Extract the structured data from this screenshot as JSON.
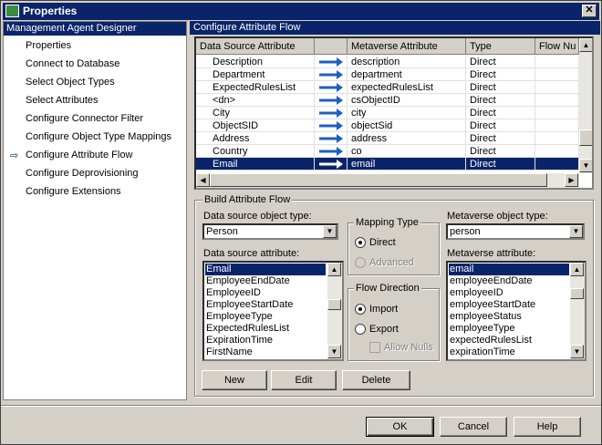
{
  "window": {
    "title": "Properties",
    "close_glyph": "✕"
  },
  "left_pane": {
    "header": "Management Agent Designer",
    "items": [
      {
        "label": "Properties"
      },
      {
        "label": "Connect to Database"
      },
      {
        "label": "Select Object Types"
      },
      {
        "label": "Select Attributes"
      },
      {
        "label": "Configure Connector Filter"
      },
      {
        "label": "Configure Object Type Mappings"
      },
      {
        "label": "Configure Attribute Flow",
        "current": true
      },
      {
        "label": "Configure Deprovisioning"
      },
      {
        "label": "Configure Extensions"
      }
    ],
    "current_arrow": "⇨"
  },
  "main": {
    "header": "Configure Attribute Flow",
    "grid": {
      "columns": [
        "Data Source Attribute",
        "",
        "Metaverse Attribute",
        "Type",
        "Flow Nu"
      ],
      "rows": [
        {
          "source": "Description",
          "metaverse": "description",
          "type": "Direct"
        },
        {
          "source": "Department",
          "metaverse": "department",
          "type": "Direct"
        },
        {
          "source": "ExpectedRulesList",
          "metaverse": "expectedRulesList",
          "type": "Direct"
        },
        {
          "source": "<dn>",
          "metaverse": "csObjectID",
          "type": "Direct"
        },
        {
          "source": "City",
          "metaverse": "city",
          "type": "Direct"
        },
        {
          "source": "ObjectSID",
          "metaverse": "objectSid",
          "type": "Direct"
        },
        {
          "source": "Address",
          "metaverse": "address",
          "type": "Direct"
        },
        {
          "source": "Country",
          "metaverse": "co",
          "type": "Direct"
        },
        {
          "source": "Email",
          "metaverse": "email",
          "type": "Direct",
          "selected": true
        }
      ]
    },
    "build": {
      "group_label": "Build Attribute Flow",
      "ds_object_type_label": "Data source object type:",
      "ds_object_type_value": "Person",
      "mv_object_type_label": "Metaverse object type:",
      "mv_object_type_value": "person",
      "ds_attribute_label": "Data source attribute:",
      "ds_attributes": [
        "Email",
        "EmployeeEndDate",
        "EmployeeID",
        "EmployeeStartDate",
        "EmployeeType",
        "ExpectedRulesList",
        "ExpirationTime",
        "FirstName"
      ],
      "mv_attribute_label": "Metaverse attribute:",
      "mv_attributes": [
        "email",
        "employeeEndDate",
        "employeeID",
        "employeeStartDate",
        "employeeStatus",
        "employeeType",
        "expectedRulesList",
        "expirationTime"
      ],
      "mapping_type": {
        "label": "Mapping Type",
        "direct": "Direct",
        "advanced": "Advanced"
      },
      "flow_direction": {
        "label": "Flow Direction",
        "import": "Import",
        "export": "Export",
        "allow_nulls": "Allow Nulls"
      },
      "buttons": {
        "new": "New",
        "edit": "Edit",
        "delete": "Delete"
      }
    }
  },
  "footer": {
    "ok": "OK",
    "cancel": "Cancel",
    "help": "Help"
  },
  "colors": {
    "selection": "#0a246a",
    "face": "#d4d0c8",
    "arrow": "#1f5fbf"
  }
}
